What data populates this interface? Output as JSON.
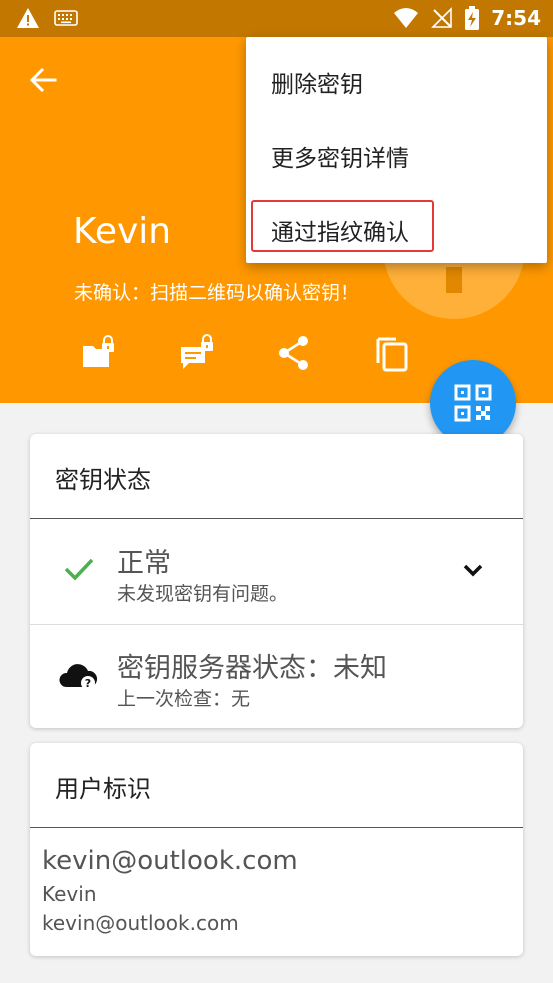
{
  "statusbar": {
    "time": "7:54"
  },
  "header": {
    "name": "Kevin",
    "status_text": "未确认：扫描二维码以确认密钥！"
  },
  "menu": {
    "items": [
      "删除密钥",
      "更多密钥详情",
      "通过指纹确认"
    ]
  },
  "key_status": {
    "title": "密钥状态",
    "rows": [
      {
        "title": "正常",
        "subtitle": "未发现密钥有问题。"
      },
      {
        "title": "密钥服务器状态：未知",
        "subtitle": "上一次检查：无"
      }
    ]
  },
  "user_ids": {
    "title": "用户标识",
    "primary": "kevin@outlook.com",
    "name": "Kevin",
    "email": "kevin@outlook.com"
  },
  "colors": {
    "appbar": "#ff9800",
    "statusbar": "#c27800",
    "fab": "#2196f3",
    "check": "#4caf50",
    "highlight": "#e53935"
  }
}
